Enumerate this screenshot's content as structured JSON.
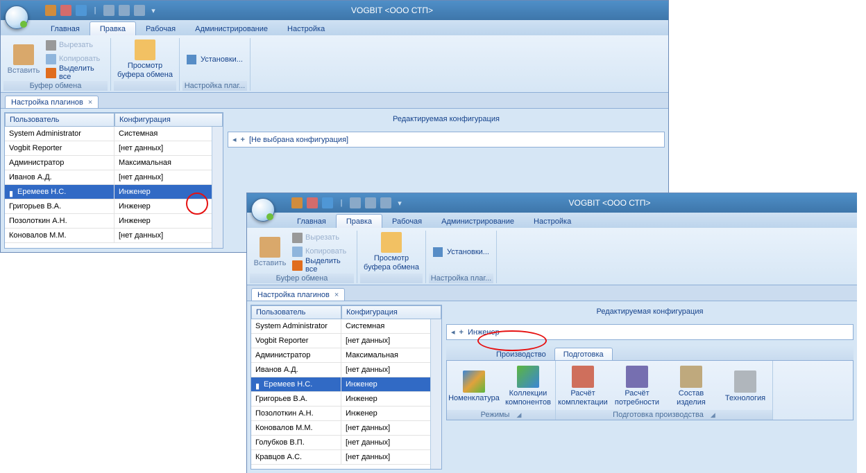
{
  "app_title": "VOGBIT <ООО СТП>",
  "menu": {
    "main": "Главная",
    "edit": "Правка",
    "work": "Рабочая",
    "admin": "Администрирование",
    "settings": "Настройка"
  },
  "ribbon": {
    "paste": "Вставить",
    "cut": "Вырезать",
    "copy": "Копировать",
    "select_all": "Выделить все",
    "clipboard_group": "Буфер обмена",
    "view": "Просмотр буфера обмена",
    "install": "Установки...",
    "plugin_group": "Настройка плаг..."
  },
  "doc_tab": "Настройка плагинов",
  "grid": {
    "h_user": "Пользователь",
    "h_config": "Конфигурация",
    "rows": [
      {
        "user": "System Administrator",
        "config": "Системная"
      },
      {
        "user": "Vogbit Reporter",
        "config": "[нет данных]"
      },
      {
        "user": "Администратор",
        "config": "Максимальная"
      },
      {
        "user": "Иванов А.Д.",
        "config": "[нет данных]"
      },
      {
        "user": "Еремеев Н.С.",
        "config": "Инженер",
        "selected": true
      },
      {
        "user": "Григорьев В.А.",
        "config": "Инженер"
      },
      {
        "user": "Позолоткин А.Н.",
        "config": "Инженер"
      },
      {
        "user": "Коновалов М.М.",
        "config": "[нет данных]"
      }
    ],
    "rows2": [
      {
        "user": "System Administrator",
        "config": "Системная"
      },
      {
        "user": "Vogbit Reporter",
        "config": "[нет данных]"
      },
      {
        "user": "Администратор",
        "config": "Максимальная"
      },
      {
        "user": "Иванов А.Д.",
        "config": "[нет данных]"
      },
      {
        "user": "Еремеев Н.С.",
        "config": "Инженер",
        "selected": true
      },
      {
        "user": "Григорьев В.А.",
        "config": "Инженер"
      },
      {
        "user": "Позолоткин А.Н.",
        "config": "Инженер"
      },
      {
        "user": "Коновалов М.М.",
        "config": "[нет данных]"
      },
      {
        "user": "Голубков В.П.",
        "config": "[нет данных]"
      },
      {
        "user": "Кравцов А.С.",
        "config": "[нет данных]"
      }
    ]
  },
  "right": {
    "title": "Редактируемая конфигурация",
    "empty": "[Не выбрана конфигурация]",
    "selected": "Инженер"
  },
  "w2": {
    "tabs": {
      "prod": "Производство",
      "prep": "Подготовка"
    },
    "buttons": {
      "nomenclature": "Номенклатура",
      "collections": "Коллекции компонентов",
      "calc_complect": "Расчёт комплектации",
      "calc_need": "Расчёт потребности",
      "composition": "Состав изделия",
      "technology": "Технология"
    },
    "groups": {
      "modes": "Режимы",
      "prep_prod": "Подготовка производства"
    }
  }
}
